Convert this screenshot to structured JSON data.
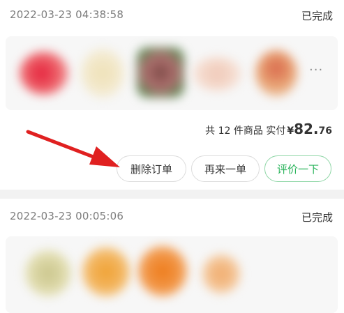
{
  "orders": [
    {
      "time": "2022-03-23 04:38:58",
      "status": "已完成",
      "more_icon": "ellipsis-icon",
      "summary": {
        "prefix": "共",
        "count": "12",
        "count_unit": "件商品",
        "paid_label": "实付",
        "currency": "¥",
        "price_int": "82.",
        "price_dec": "76"
      },
      "buttons": {
        "delete": "删除订单",
        "reorder": "再来一单",
        "review": "评价一下"
      }
    },
    {
      "time": "2022-03-23 00:05:06",
      "status": "已完成"
    }
  ],
  "colors": {
    "accent_green": "#2bb45c",
    "annotation_arrow": "#e02020"
  }
}
